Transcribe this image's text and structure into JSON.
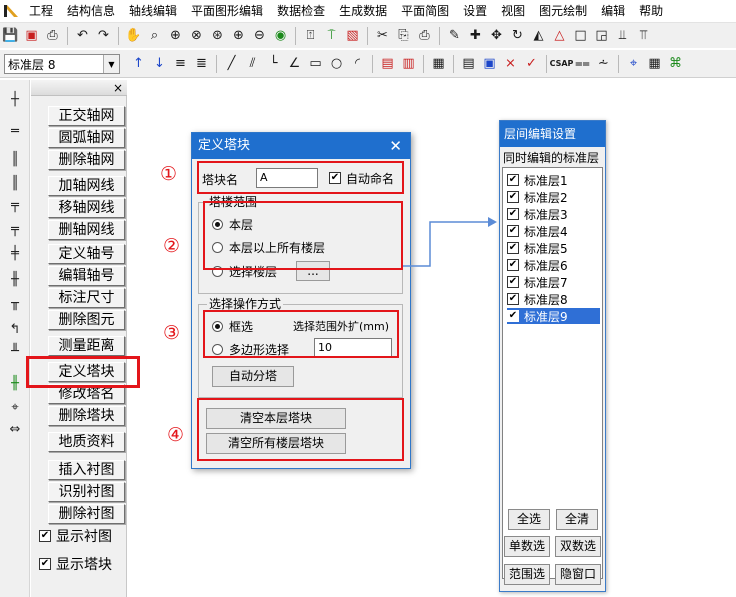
{
  "menu": [
    "工程",
    "结构信息",
    "轴线编辑",
    "平面图形编辑",
    "数据检查",
    "生成数据",
    "平面简图",
    "设置",
    "视图",
    "图元绘制",
    "编辑",
    "帮助"
  ],
  "layer_select": {
    "value": "标准层 8"
  },
  "side_panel": {
    "close": "×",
    "buttons": [
      "正交轴网",
      "圆弧轴网",
      "删除轴网",
      "加轴网线",
      "移轴网线",
      "删轴网线",
      "定义轴号",
      "编辑轴号",
      "标注尺寸",
      "删除图元",
      "测量距离",
      "定义塔块",
      "修改塔名",
      "删除塔块",
      "地质资料",
      "插入衬图",
      "识别衬图",
      "删除衬图"
    ],
    "checks": [
      {
        "label": "显示衬图",
        "checked": true
      },
      {
        "label": "显示塔块",
        "checked": true
      }
    ]
  },
  "dialog": {
    "title": "定义塔块",
    "close": "✕",
    "name_label": "塔块名",
    "name_value": "A",
    "auto_name": {
      "label": "自动命名",
      "checked": true
    },
    "range_group": "塔楼范围",
    "range_options": [
      "本层",
      "本层以上所有楼层",
      "选择楼层"
    ],
    "range_selected": 0,
    "browse_button": "...",
    "op_group": "选择操作方式",
    "op_options": [
      "框选",
      "多边形选择"
    ],
    "op_selected": 0,
    "expand_label": "选择范围外扩(mm)",
    "expand_value": "10",
    "auto_split_button": "自动分塔",
    "clear_floor_button": "清空本层塔块",
    "clear_all_button": "清空所有楼层塔块"
  },
  "annotations": [
    "①",
    "②",
    "③",
    "④"
  ],
  "floor_panel": {
    "title": "层间编辑设置",
    "subtitle": "同时编辑的标准层",
    "floors": [
      "标准层1",
      "标准层2",
      "标准层3",
      "标准层4",
      "标准层5",
      "标准层6",
      "标准层7",
      "标准层8",
      "标准层9"
    ],
    "selected_index": 8,
    "buttons": [
      "全选",
      "全清",
      "单数选",
      "双数选",
      "范围选",
      "隐窗口"
    ]
  },
  "colors": {
    "accent": "#1f6fce",
    "highlight": "#e3151a",
    "selection": "#2f6fd6"
  }
}
